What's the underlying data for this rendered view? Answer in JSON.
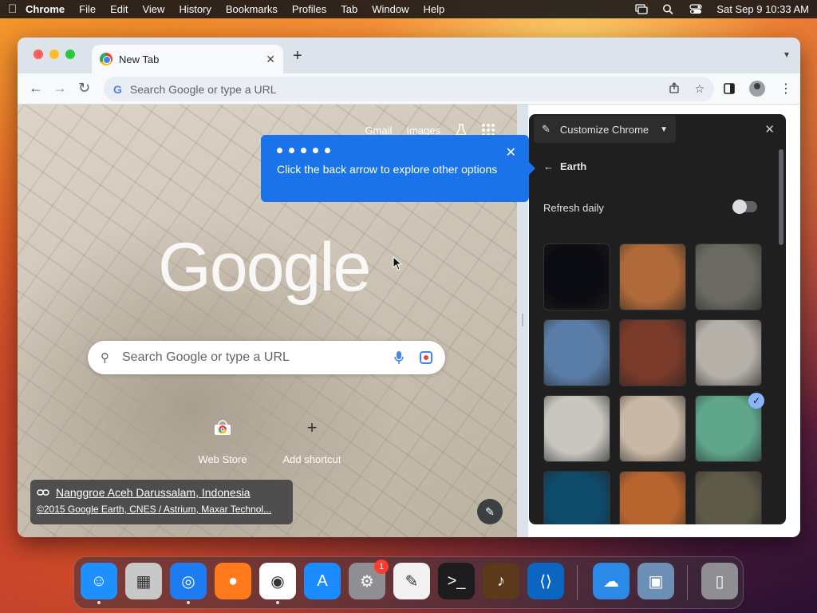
{
  "menubar": {
    "app": "Chrome",
    "items": [
      "File",
      "Edit",
      "View",
      "History",
      "Bookmarks",
      "Profiles",
      "Tab",
      "Window",
      "Help"
    ],
    "datetime": "Sat Sep 9  10:33 AM"
  },
  "browser": {
    "tab_title": "New Tab",
    "omnibox_placeholder": "Search Google or type a URL"
  },
  "ntp": {
    "gmail": "Gmail",
    "images": "Images",
    "logo": "Google",
    "search_placeholder": "Search Google or type a URL",
    "shortcuts": [
      {
        "label": "Web Store"
      },
      {
        "label": "Add shortcut"
      }
    ],
    "attribution": {
      "location": "Nanggroe Aceh Darussalam, Indonesia",
      "credit": "©2015 Google Earth, CNES / Astrium, Maxar Technol..."
    }
  },
  "callout": {
    "message": "Click the back arrow to explore other options"
  },
  "panel": {
    "title": "Customize Chrome",
    "section": "Earth",
    "refresh_label": "Refresh daily",
    "refresh_on": false,
    "selected_index": 8,
    "thumb_colors": [
      "#0b0b12",
      "#b06a3a",
      "#6b6a62",
      "#5a7da8",
      "#7a3a2a",
      "#b5b0a8",
      "#c9c6c0",
      "#c9b8a5",
      "#5fa68c",
      "#0e4a6a",
      "#b8642e",
      "#5d5a48"
    ]
  },
  "dock": {
    "apps": [
      "Finder",
      "Launchpad",
      "Safari",
      "Firefox",
      "Chrome",
      "App Store",
      "System Settings",
      "TextEdit",
      "Terminal",
      "GarageBand",
      "VS Code",
      "Weather",
      "VirtualBox",
      "Trash"
    ],
    "settings_badge": "1"
  }
}
